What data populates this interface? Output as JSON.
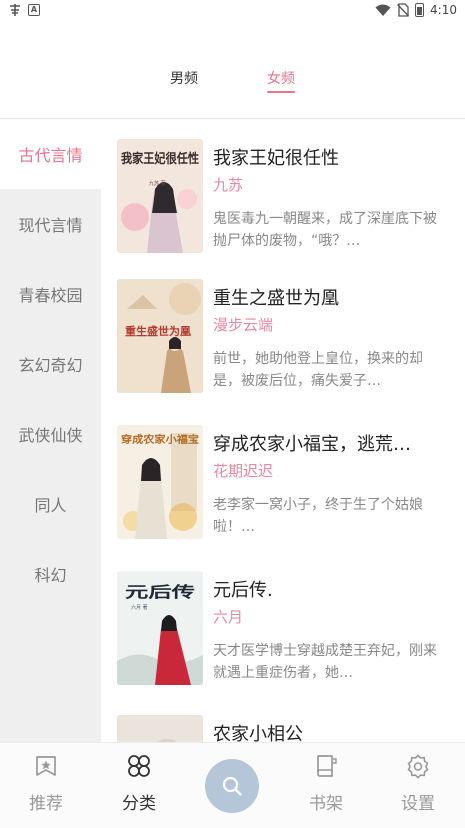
{
  "status_bar": {
    "left_icons": [
      "app-icon",
      "a-icon"
    ],
    "right_icons": [
      "wifi-icon",
      "no-sim-icon",
      "battery-icon"
    ],
    "time": "4:10"
  },
  "top_tabs": [
    {
      "label": "男频",
      "active": false
    },
    {
      "label": "女频",
      "active": true
    }
  ],
  "sidebar": {
    "items": [
      {
        "label": "古代言情",
        "active": true
      },
      {
        "label": "现代言情",
        "active": false
      },
      {
        "label": "青春校园",
        "active": false
      },
      {
        "label": "玄幻奇幻",
        "active": false
      },
      {
        "label": "武侠仙侠",
        "active": false
      },
      {
        "label": "同人",
        "active": false
      },
      {
        "label": "科幻",
        "active": false
      }
    ]
  },
  "books": [
    {
      "title": "我家王妃很任性",
      "author": "九苏",
      "description": "鬼医毒九一朝醒来，成了深崖底下被抛尸体的废物，“哦？…",
      "cover_text": "我家王妃很任性",
      "cover_small": "九苏 著"
    },
    {
      "title": "重生之盛世为凰",
      "author": "漫步云端",
      "description": "前世，她助他登上皇位，换来的却是，被废后位，痛失爱子…",
      "cover_text": "重生盛世为凰"
    },
    {
      "title": "穿成农家小福宝，逃荒…",
      "author": "花期迟迟",
      "description": "老李家一窝小子，终于生了个姑娘啦！…",
      "cover_text": "穿成农家小福宝"
    },
    {
      "title": "元后传.",
      "author": "六月",
      "description": "天才医学博士穿越成楚王弃妃，刚来就遇上重症伤者，她…",
      "cover_text": "元后传",
      "cover_small": "六月 著"
    },
    {
      "title": "农家小相公",
      "author": "",
      "description": ""
    }
  ],
  "bottom_nav": {
    "items": [
      {
        "label": "推荐",
        "icon": "recommend-icon",
        "active": false
      },
      {
        "label": "分类",
        "icon": "category-icon",
        "active": true
      },
      {
        "label": "书架",
        "icon": "bookshelf-icon",
        "active": false
      },
      {
        "label": "设置",
        "icon": "settings-icon",
        "active": false
      }
    ],
    "center_button_icon": "search-icon"
  },
  "colors": {
    "accent": "#e7748e",
    "author": "#e68aa0",
    "sidebar_bg": "#efefef",
    "search_button": "#b4c6d7"
  }
}
